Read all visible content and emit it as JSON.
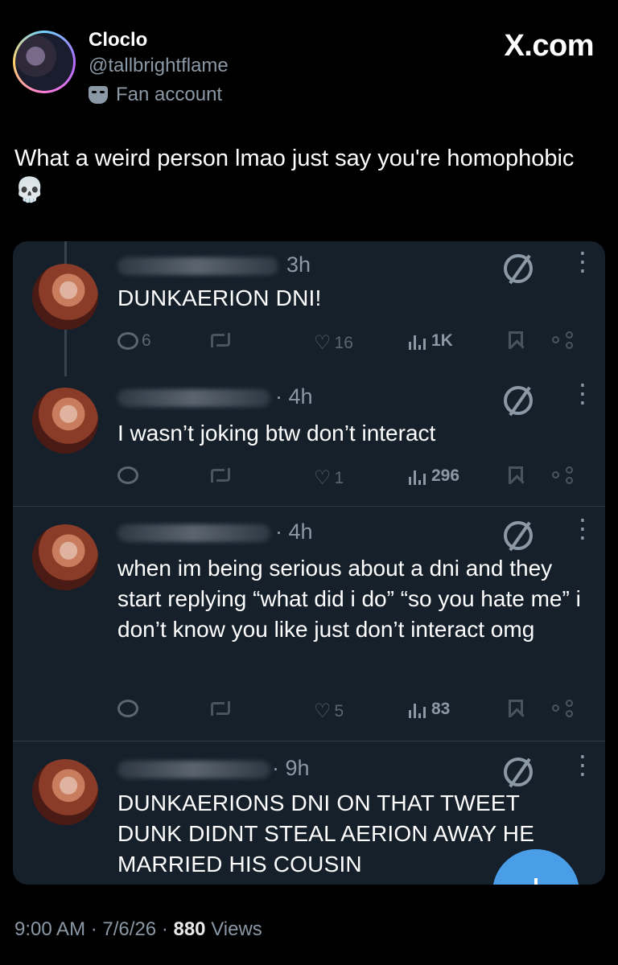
{
  "profile": {
    "display_name": "Cloclo",
    "handle": "@tallbrightflame",
    "badge_label": "Fan account",
    "brand": "X.com"
  },
  "tweet": {
    "text": "What a weird person lmao just say you're homophobic",
    "emoji": "💀"
  },
  "replies": [
    {
      "time": "3h",
      "body": "DUNKAERION DNI!",
      "comments": "6",
      "likes": "16",
      "views": "1K"
    },
    {
      "time": "· 4h",
      "body": "I wasn’t joking btw don’t interact",
      "comments": "",
      "likes": "1",
      "views": "296"
    },
    {
      "time": "· 4h",
      "body": "when im being serious about a dni and they start replying “what did i do” “so you hate me” i don’t know you like just don’t interact omg",
      "comments": "",
      "likes": "5",
      "views": "83"
    },
    {
      "time": "· 9h",
      "body": "DUNKAERIONS DNI ON THAT TWEET DUNK DIDNT STEAL AERION AWAY HE MARRIED HIS COUSIN",
      "comments": "",
      "likes": "",
      "views": ""
    }
  ],
  "footer": {
    "time": "9:00 AM",
    "date": "7/6/26",
    "views_count": "880",
    "views_label": "Views"
  },
  "colors": {
    "background": "#000000",
    "card": "#15202b",
    "muted": "#8b98a5",
    "accent": "#4a9ee8"
  },
  "icons": [
    "mask-icon",
    "skull-emoji",
    "slash-circle-icon",
    "more-icon",
    "reply-icon",
    "retweet-icon",
    "like-icon",
    "views-icon",
    "bookmark-icon",
    "share-icon"
  ]
}
